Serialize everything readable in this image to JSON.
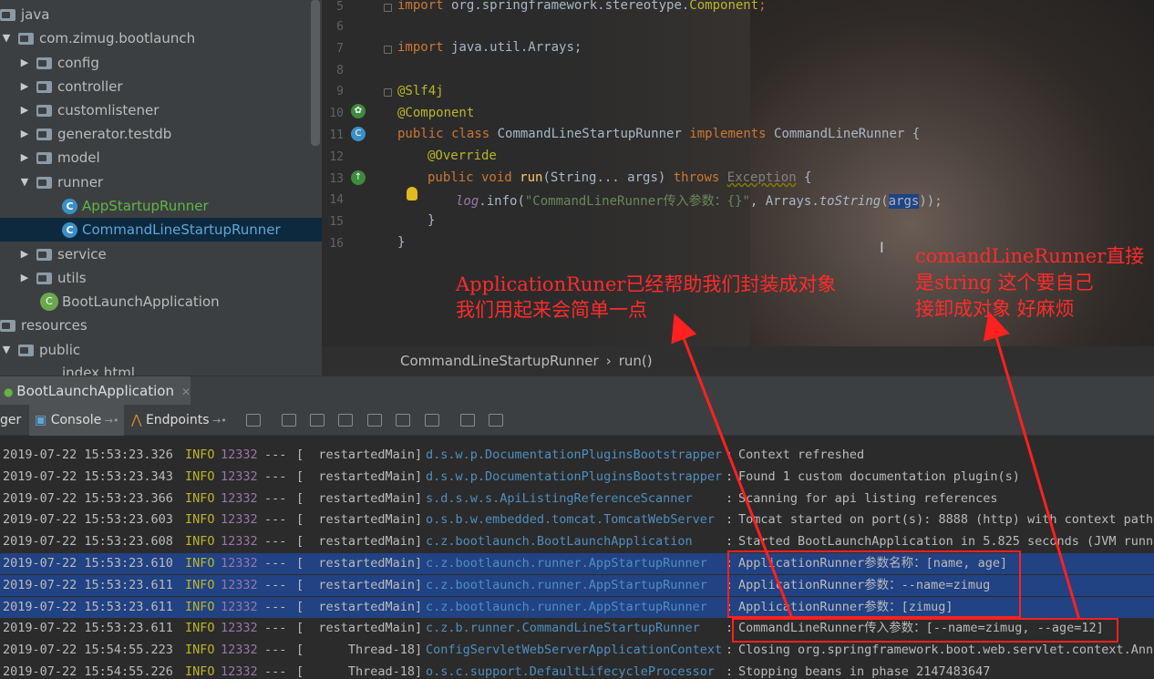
{
  "tree": {
    "items": [
      {
        "label": "java",
        "type": "folder",
        "open": false
      },
      {
        "label": "com.zimug.bootlaunch",
        "type": "folder",
        "open": true
      },
      {
        "label": "config",
        "type": "folder",
        "open": false
      },
      {
        "label": "controller",
        "type": "folder",
        "open": false
      },
      {
        "label": "customlistener",
        "type": "folder",
        "open": false
      },
      {
        "label": "generator.testdb",
        "type": "folder",
        "open": false
      },
      {
        "label": "model",
        "type": "folder",
        "open": false
      },
      {
        "label": "runner",
        "type": "folder",
        "open": true
      },
      {
        "label": "AppStartupRunner",
        "type": "class"
      },
      {
        "label": "CommandLineStartupRunner",
        "type": "class",
        "selected": true
      },
      {
        "label": "service",
        "type": "folder",
        "open": false
      },
      {
        "label": "utils",
        "type": "folder",
        "open": false
      },
      {
        "label": "BootLaunchApplication",
        "type": "spring"
      },
      {
        "label": "resources",
        "type": "folder"
      },
      {
        "label": "public",
        "type": "folder",
        "open": true
      },
      {
        "label": "index.html",
        "type": "file"
      }
    ]
  },
  "editor": {
    "line_numbers": [
      "5",
      "6",
      "7",
      "8",
      "9",
      "10",
      "11",
      "12",
      "13",
      "14",
      "15",
      "16"
    ],
    "lines": {
      "l5_kw": "import",
      "l5_rest": " org.springframework.stereotype.",
      "l5_cls": "Component",
      "l5_end": ";",
      "l7_kw": "import",
      "l7_rest": " java.util.Arrays;",
      "l9": "@Slf4j",
      "l10": "@Component",
      "l11_kw": "public class",
      "l11_name": " CommandLineStartupRunner ",
      "l11_kw2": "implements",
      "l11_rest": " CommandLineRunner {",
      "l12": "@Override",
      "l13_kw": "public void ",
      "l13_fn": "run",
      "l13_a": "(String... ",
      "l13_args": "args",
      "l13_b": ") ",
      "l13_kw2": "throws ",
      "l13_exc": "Exception",
      "l13_c": " {",
      "l14_log": "log",
      "l14_a": ".info(",
      "l14_str": "\"CommandLineRunner传入参数：{}\"",
      "l14_b": ", Arrays.",
      "l14_fn": "toString",
      "l14_c": "(",
      "l14_args": "args",
      "l14_d": "));",
      "l15": "}",
      "l16": "}"
    },
    "breadcrumb": [
      "CommandLineStartupRunner",
      "›",
      "run()"
    ]
  },
  "run": {
    "tab_label": "BootLaunchApplication",
    "toolbar": {
      "debugger_partial": "ger",
      "console": "Console",
      "endpoints": "Endpoints"
    }
  },
  "console": {
    "rows": [
      {
        "ts": "2019-07-22 15:53:23.326",
        "lvl": "INFO",
        "pid": "12332",
        "dash": "---",
        "thr": "[  restartedMain]",
        "logger": "d.s.w.p.DocumentationPluginsBootstrapper",
        "colon": ":",
        "msg": "Context refreshed"
      },
      {
        "ts": "2019-07-22 15:53:23.343",
        "lvl": "INFO",
        "pid": "12332",
        "dash": "---",
        "thr": "[  restartedMain]",
        "logger": "d.s.w.p.DocumentationPluginsBootstrapper",
        "colon": ":",
        "msg": "Found 1 custom documentation plugin(s)"
      },
      {
        "ts": "2019-07-22 15:53:23.366",
        "lvl": "INFO",
        "pid": "12332",
        "dash": "---",
        "thr": "[  restartedMain]",
        "logger": "s.d.s.w.s.ApiListingReferenceScanner",
        "colon": ":",
        "msg": "Scanning for api listing references"
      },
      {
        "ts": "2019-07-22 15:53:23.603",
        "lvl": "INFO",
        "pid": "12332",
        "dash": "---",
        "thr": "[  restartedMain]",
        "logger": "o.s.b.w.embedded.tomcat.TomcatWebServer",
        "colon": ":",
        "msg": "Tomcat started on port(s): 8888 (http) with context path"
      },
      {
        "ts": "2019-07-22 15:53:23.608",
        "lvl": "INFO",
        "pid": "12332",
        "dash": "---",
        "thr": "[  restartedMain]",
        "logger": "c.z.bootlaunch.BootLaunchApplication",
        "colon": ":",
        "msg": "Started BootLaunchApplication in 5.825 seconds (JVM runni"
      },
      {
        "ts": "2019-07-22 15:53:23.610",
        "lvl": "INFO",
        "pid": "12332",
        "dash": "---",
        "thr": "[  restartedMain]",
        "logger": "c.z.bootlaunch.runner.AppStartupRunner",
        "colon": ":",
        "msg": "ApplicationRunner参数名称：[name, age]",
        "sel": true
      },
      {
        "ts": "2019-07-22 15:53:23.611",
        "lvl": "INFO",
        "pid": "12332",
        "dash": "---",
        "thr": "[  restartedMain]",
        "logger": "c.z.bootlaunch.runner.AppStartupRunner",
        "colon": ":",
        "msg": "ApplicationRunner参数：--name=zimug",
        "sel": true
      },
      {
        "ts": "2019-07-22 15:53:23.611",
        "lvl": "INFO",
        "pid": "12332",
        "dash": "---",
        "thr": "[  restartedMain]",
        "logger": "c.z.bootlaunch.runner.AppStartupRunner",
        "colon": ":",
        "msg": "ApplicationRunner参数：[zimug]",
        "sel": true
      },
      {
        "ts": "2019-07-22 15:53:23.611",
        "lvl": "INFO",
        "pid": "12332",
        "dash": "---",
        "thr": "[  restartedMain]",
        "logger": "c.z.b.runner.CommandLineStartupRunner",
        "colon": ":",
        "msg": "CommandLineRunner传入参数：[--name=zimug, --age=12]"
      },
      {
        "ts": "2019-07-22 15:54:55.223",
        "lvl": "INFO",
        "pid": "12332",
        "dash": "---",
        "thr": "[      Thread-18]",
        "logger": "ConfigServletWebServerApplicationContext",
        "colon": ":",
        "msg": "Closing org.springframework.boot.web.servlet.context.Anno"
      },
      {
        "ts": "2019-07-22 15:54:55.226",
        "lvl": "INFO",
        "pid": "12332",
        "dash": "---",
        "thr": "[      Thread-18]",
        "logger": "o.s.c.support.DefaultLifecycleProcessor",
        "colon": ":",
        "msg": "Stopping beans in phase 2147483647"
      }
    ]
  },
  "annotations": {
    "left_line1": "ApplicationRuner已经帮助我们封装成对象",
    "left_line2": "我们用起来会简单一点",
    "right_line1": "comandLineRunner直接",
    "right_line2": "是string  这个要自己",
    "right_line3": "接卸成对象 好麻烦",
    "color": "#ff2b2b"
  }
}
